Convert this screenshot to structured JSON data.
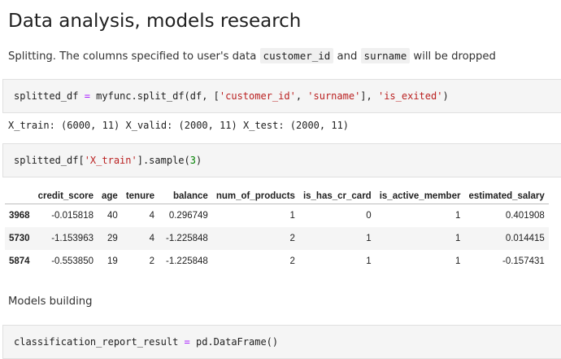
{
  "title": "Data analysis, models research",
  "split_text": {
    "before": "Splitting. The columns specified to user's data ",
    "code1": "customer_id",
    "middle": " and ",
    "code2": "surname",
    "after": " will be dropped"
  },
  "cell1": {
    "var": "splitted_df",
    "op": " = ",
    "call": "myfunc.split_df(df, [",
    "s1": "'customer_id'",
    "sep": ", ",
    "s2": "'surname'",
    "mid": "], ",
    "s3": "'is_exited'",
    "end": ")"
  },
  "output1": "X_train: (6000, 11) X_valid: (2000, 11) X_test: (2000, 11)",
  "cell2": {
    "pre": "splitted_df[",
    "s1": "'X_train'",
    "mid": "].sample(",
    "num": "3",
    "end": ")"
  },
  "table": {
    "columns": [
      "",
      "credit_score",
      "age",
      "tenure",
      "balance",
      "num_of_products",
      "is_has_cr_card",
      "is_active_member",
      "estimated_salary"
    ],
    "rows": [
      [
        "3968",
        "-0.015818",
        "40",
        "4",
        "0.296749",
        "1",
        "0",
        "1",
        "0.401908"
      ],
      [
        "5730",
        "-1.153963",
        "29",
        "4",
        "-1.225848",
        "2",
        "1",
        "1",
        "0.014415"
      ],
      [
        "5874",
        "-0.553850",
        "19",
        "2",
        "-1.225848",
        "2",
        "1",
        "1",
        "-0.157431"
      ]
    ]
  },
  "models_text": "Models building",
  "cell3": {
    "pre": "classification_report_result ",
    "op": "=",
    "post": " pd.DataFrame()"
  }
}
